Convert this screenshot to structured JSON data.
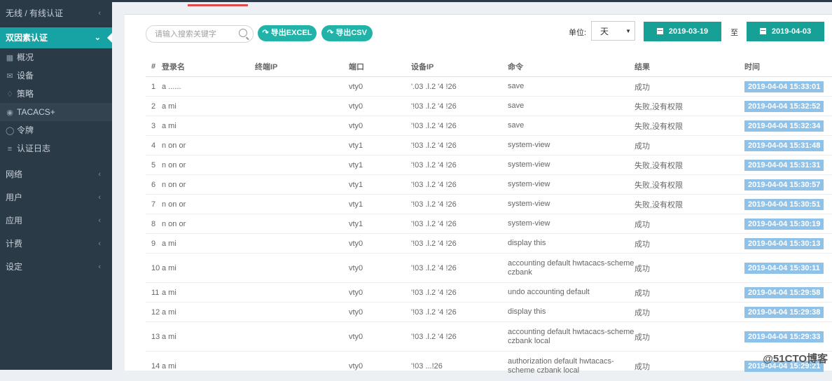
{
  "sidebar": {
    "header": "无线 / 有线认证",
    "active_section": "双因素认证",
    "sub_items": [
      {
        "label": "概况",
        "icon": "grid-icon"
      },
      {
        "label": "设备",
        "icon": "mail-icon"
      },
      {
        "label": "策略",
        "icon": "tag-icon"
      },
      {
        "label": "TACACS+",
        "icon": "globe-icon"
      },
      {
        "label": "令牌",
        "icon": "shield-icon"
      },
      {
        "label": "认证日志",
        "icon": "list-icon"
      }
    ],
    "groups": [
      "网络",
      "用户",
      "应用",
      "计费",
      "设定"
    ]
  },
  "toolbar": {
    "search_placeholder": "请输入搜索关键字",
    "export_excel": "导出EXCEL",
    "export_csv": "导出CSV",
    "unit_label": "单位:",
    "unit_value": "天",
    "date_from": "2019-03-19",
    "to_label": "至",
    "date_to": "2019-04-03"
  },
  "table": {
    "headers": [
      "#",
      "登录名",
      "终端IP",
      "端口",
      "设备IP",
      "命令",
      "结果",
      "时间"
    ],
    "rows": [
      {
        "n": "1",
        "login": "a ......",
        "term_ip": "",
        "port": "vty0",
        "dev_ip": "'.03 .l.2 '4 !26",
        "cmd": "save",
        "result": "成功",
        "time": "2019-04-04 15:33:01"
      },
      {
        "n": "2",
        "login": "a mi",
        "term_ip": "",
        "port": "vty0",
        "dev_ip": "'!03 .l.2 '4 !26",
        "cmd": "save",
        "result": "失败,没有权限",
        "time": "2019-04-04 15:32:52"
      },
      {
        "n": "3",
        "login": "a mi",
        "term_ip": "",
        "port": "vty0",
        "dev_ip": "'!03 .l.2 '4 !26",
        "cmd": "save",
        "result": "失败,没有权限",
        "time": "2019-04-04 15:32:34"
      },
      {
        "n": "4",
        "login": "n on or",
        "term_ip": "",
        "port": "vty1",
        "dev_ip": "'!03 .l.2 '4 !26",
        "cmd": "system-view",
        "result": "成功",
        "time": "2019-04-04 15:31:48"
      },
      {
        "n": "5",
        "login": "n on or",
        "term_ip": "",
        "port": "vty1",
        "dev_ip": "'!03 .l.2 '4 !26",
        "cmd": "system-view",
        "result": "失败,没有权限",
        "time": "2019-04-04 15:31:31"
      },
      {
        "n": "6",
        "login": "n on or",
        "term_ip": "",
        "port": "vty1",
        "dev_ip": "'!03 .l.2 '4 !26",
        "cmd": "system-view",
        "result": "失败,没有权限",
        "time": "2019-04-04 15:30:57"
      },
      {
        "n": "7",
        "login": "n on or",
        "term_ip": "",
        "port": "vty1",
        "dev_ip": "'!03 .l.2 '4 !26",
        "cmd": "system-view",
        "result": "失败,没有权限",
        "time": "2019-04-04 15:30:51"
      },
      {
        "n": "8",
        "login": "n on or",
        "term_ip": "",
        "port": "vty1",
        "dev_ip": "'!03 .l.2 '4 !26",
        "cmd": "system-view",
        "result": "成功",
        "time": "2019-04-04 15:30:19"
      },
      {
        "n": "9",
        "login": "a mi",
        "term_ip": "",
        "port": "vty0",
        "dev_ip": "'!03 .l.2 '4 !26",
        "cmd": "display this",
        "result": "成功",
        "time": "2019-04-04 15:30:13"
      },
      {
        "n": "10",
        "login": "a mi",
        "term_ip": "",
        "port": "vty0",
        "dev_ip": "'!03 .l.2 '4 !26",
        "cmd": "accounting default hwtacacs-scheme czbank",
        "result": "成功",
        "time": "2019-04-04 15:30:11"
      },
      {
        "n": "11",
        "login": "a mi",
        "term_ip": "",
        "port": "vty0",
        "dev_ip": "'!03 .l.2 '4 !26",
        "cmd": "undo accounting default",
        "result": "成功",
        "time": "2019-04-04 15:29:58"
      },
      {
        "n": "12",
        "login": "a mi",
        "term_ip": "",
        "port": "vty0",
        "dev_ip": "'!03 .l.2 '4 !26",
        "cmd": "display this",
        "result": "成功",
        "time": "2019-04-04 15:29:38"
      },
      {
        "n": "13",
        "login": "a mi",
        "term_ip": "",
        "port": "vty0",
        "dev_ip": "'!03 .l.2 '4 !26",
        "cmd": "accounting default hwtacacs-scheme czbank local",
        "result": "成功",
        "time": "2019-04-04 15:29:33"
      },
      {
        "n": "14",
        "login": "a mi",
        "term_ip": "",
        "port": "vty0",
        "dev_ip": "'!03 ...!26",
        "cmd": "authorization default hwtacacs-scheme czbank local",
        "result": "成功",
        "time": "2019-04-04 15:29:21"
      }
    ]
  },
  "watermark": "@51CTO博客",
  "colors": {
    "sidebar_bg": "#2b3a47",
    "accent": "#17a2a4",
    "time_badge": "#8fc2e8",
    "tab_underline": "#dd4b4b"
  }
}
